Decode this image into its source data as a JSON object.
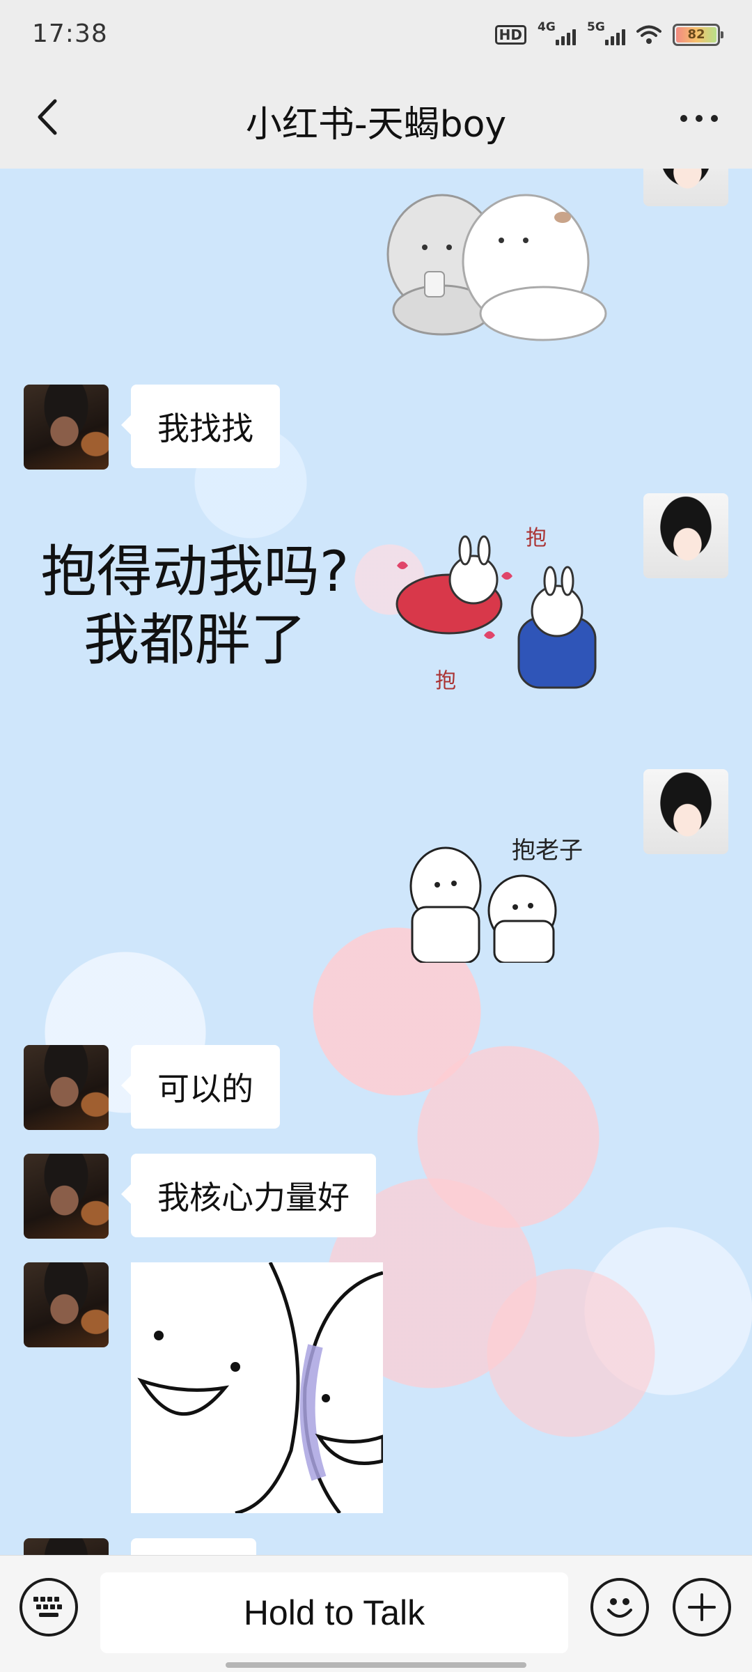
{
  "status_bar": {
    "time": "17:38",
    "hd_label": "HD",
    "network_1": "4G",
    "network_2": "5G",
    "battery_level": "82"
  },
  "header": {
    "title": "小红书-天蝎boy",
    "back_icon": "chevron-left-icon",
    "more_icon": "more-horizontal-icon"
  },
  "messages": {
    "m1": {
      "from": "me",
      "type": "sticker",
      "icon": "hugging-cats-sticker"
    },
    "m2": {
      "from": "other",
      "type": "text",
      "text": "我找找"
    },
    "m3": {
      "from": "me",
      "type": "sticker",
      "icon": "hug-rabbits-sticker",
      "caption_line1": "抱得动我吗?",
      "caption_line2": "我都胖了",
      "sticker_text_1": "抱",
      "sticker_text_2": "抱"
    },
    "m4": {
      "from": "me",
      "type": "sticker",
      "icon": "hug-blobs-sticker",
      "sticker_text": "抱老子"
    },
    "m5": {
      "from": "other",
      "type": "text",
      "text": "可以的"
    },
    "m6": {
      "from": "other",
      "type": "text",
      "text": "我核心力量好"
    },
    "m7": {
      "from": "other",
      "type": "sticker",
      "icon": "smiling-blobs-sticker"
    }
  },
  "input_bar": {
    "keyboard_icon": "keyboard-icon",
    "talk_label": "Hold to Talk",
    "emoji_icon": "emoji-icon",
    "plus_icon": "plus-icon"
  },
  "colors": {
    "chat_background": "#cfe6fb",
    "bubble": "#ffffff",
    "bar": "#ededed"
  }
}
